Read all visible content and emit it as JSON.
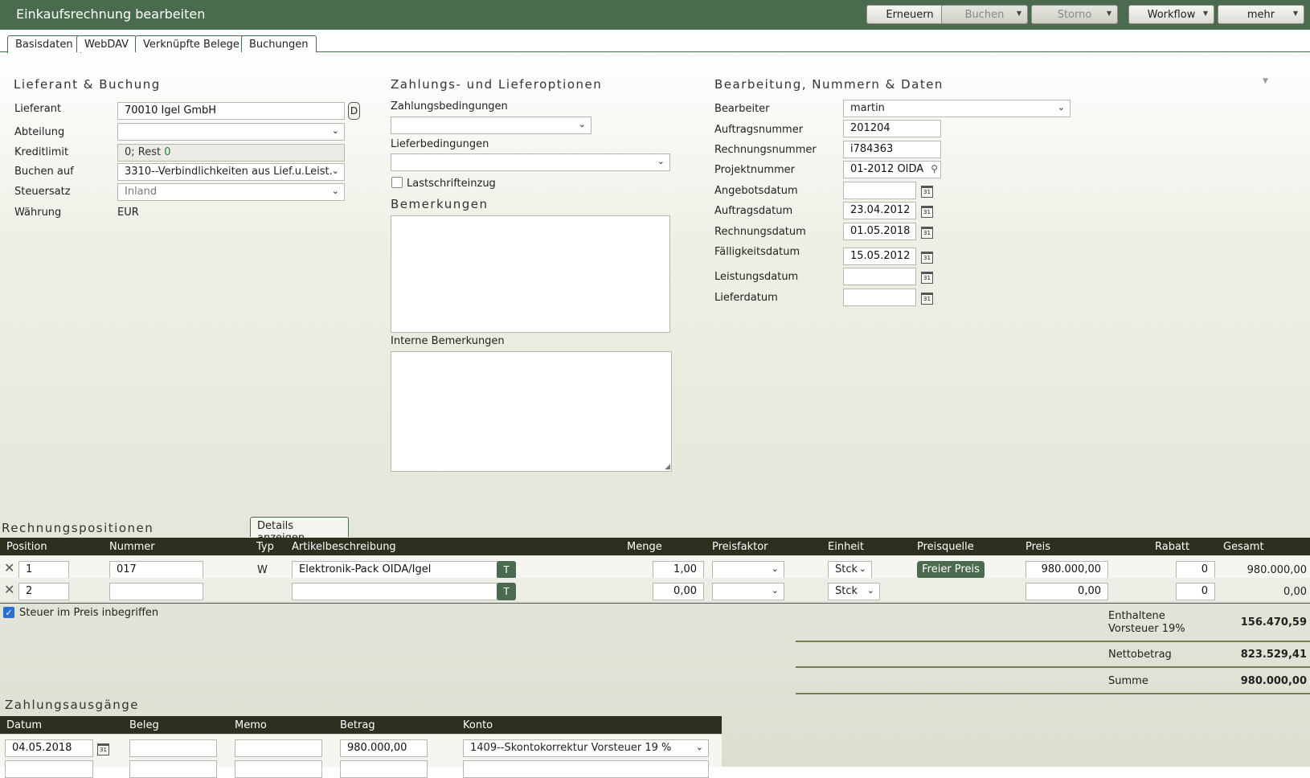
{
  "header": {
    "title": "Einkaufsrechnung bearbeiten",
    "buttons": {
      "renew": "Erneuern",
      "book": "Buchen",
      "storno": "Storno",
      "workflow": "Workflow",
      "more": "mehr"
    }
  },
  "tabs": [
    "Basisdaten",
    "WebDAV",
    "Verknüpfte Belege",
    "Buchungen"
  ],
  "supplier_section": {
    "heading": "Lieferant & Buchung",
    "labels": {
      "supplier": "Lieferant",
      "department": "Abteilung",
      "credit_limit": "Kreditlimit",
      "book_on": "Buchen auf",
      "tax_rate": "Steuersatz",
      "currency": "Währung"
    },
    "values": {
      "supplier": "70010 Igel GmbH",
      "supplier_button": "D",
      "department": "",
      "credit_limit_prefix": "0; Rest ",
      "credit_limit_rest": "0",
      "book_on": "3310--Verbindlichkeiten aus Lief.u.Leist.",
      "tax_rate": "Inland",
      "currency": "EUR"
    }
  },
  "payment_section": {
    "heading": "Zahlungs- und Lieferoptionen",
    "payment_terms_label": "Zahlungsbedingungen",
    "payment_terms": "",
    "delivery_terms_label": "Lieferbedingungen",
    "delivery_terms": "",
    "direct_debit_label": "Lastschrifteinzug",
    "notes_heading": "Bemerkungen",
    "internal_notes_label": "Interne Bemerkungen"
  },
  "processing_section": {
    "heading": "Bearbeitung, Nummern & Daten",
    "labels": {
      "editor": "Bearbeiter",
      "order_no": "Auftragsnummer",
      "invoice_no": "Rechnungsnummer",
      "project_no": "Projektnummer",
      "offer_date": "Angebotsdatum",
      "order_date": "Auftragsdatum",
      "invoice_date": "Rechnungsdatum",
      "due_date": "Fälligkeitsdatum",
      "service_date": "Leistungsdatum",
      "delivery_date": "Lieferdatum"
    },
    "values": {
      "editor": "martin",
      "order_no": "201204",
      "invoice_no": "i784363",
      "project_no": "01-2012 OIDA",
      "offer_date": "",
      "order_date": "23.04.2012",
      "invoice_date": "01.05.2018",
      "due_date": "15.05.2012",
      "service_date": "",
      "delivery_date": ""
    },
    "calendar_icon_text": "31"
  },
  "positions": {
    "heading": "Rechnungspositionen",
    "details_button": "Details anzeigen",
    "columns": [
      "Position",
      "Nummer",
      "Typ",
      "Artikelbeschreibung",
      "Menge",
      "Preisfaktor",
      "Einheit",
      "Preisquelle",
      "Preis",
      "Rabatt",
      "Gesamt"
    ],
    "rows": [
      {
        "position": "1",
        "number": "017",
        "type": "W",
        "description": "Elektronik-Pack OIDA/Igel",
        "text_btn": "T",
        "quantity": "1,00",
        "price_factor": "",
        "unit": "Stck",
        "price_source": "Freier Preis",
        "price": "980.000,00",
        "discount": "0",
        "total": "980.000,00"
      },
      {
        "position": "2",
        "number": "",
        "type": "",
        "description": "",
        "text_btn": "T",
        "quantity": "0,00",
        "price_factor": "",
        "unit": "Stck",
        "price_source": "",
        "price": "0,00",
        "discount": "0",
        "total": "0,00"
      }
    ],
    "tax_included_label": "Steuer im Preis inbegriffen",
    "tax_included": true
  },
  "totals": {
    "vat_label_line1": "Enthaltene",
    "vat_label_line2": "Vorsteuer 19%",
    "vat": "156.470,59",
    "net_label": "Nettobetrag",
    "net": "823.529,41",
    "sum_label": "Summe",
    "sum": "980.000,00"
  },
  "payments": {
    "heading": "Zahlungsausgänge",
    "columns": [
      "Datum",
      "Beleg",
      "Memo",
      "Betrag",
      "Konto"
    ],
    "rows": [
      {
        "date": "04.05.2018",
        "document": "",
        "memo": "",
        "amount": "980.000,00",
        "account": "1409--Skontokorrektur Vorsteuer 19 %"
      }
    ]
  },
  "colors": {
    "header_bg": "#4b6b4f",
    "table_head_bg": "#2f2f1f",
    "checkbox_accent": "#2a6fd1"
  }
}
